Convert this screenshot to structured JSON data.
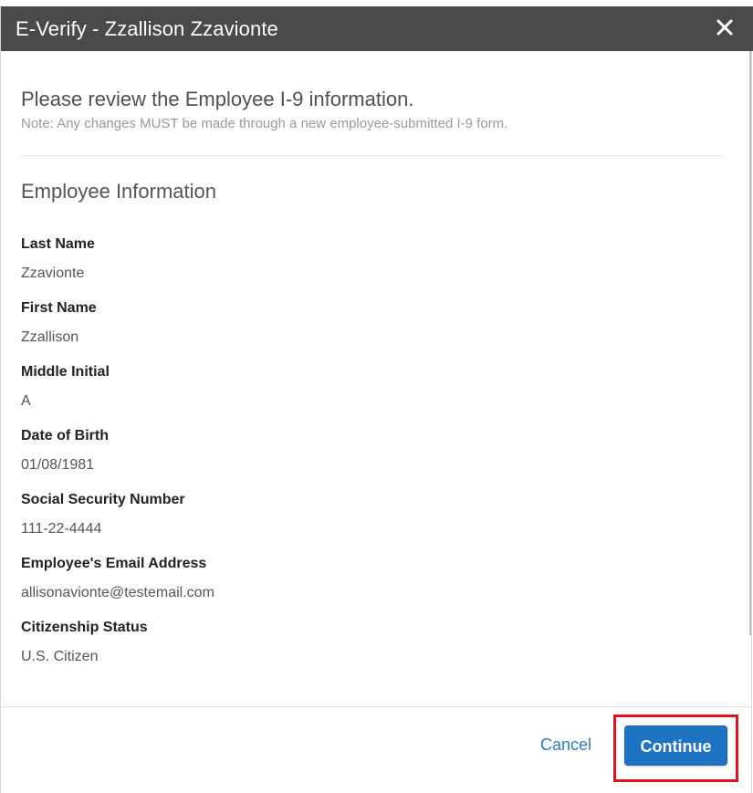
{
  "dialog": {
    "title": "E-Verify - Zzallison Zzavionte",
    "close_icon": "close-icon"
  },
  "review": {
    "heading": "Please review the Employee I-9 information.",
    "note": "Note: Any changes MUST be made through a new employee-submitted I-9 form."
  },
  "employee_section": {
    "heading": "Employee Information",
    "fields": [
      {
        "label": "Last Name",
        "value": "Zzavionte"
      },
      {
        "label": "First Name",
        "value": "Zzallison"
      },
      {
        "label": "Middle Initial",
        "value": "A"
      },
      {
        "label": "Date of Birth",
        "value": "01/08/1981"
      },
      {
        "label": "Social Security Number",
        "value": "111-22-4444"
      },
      {
        "label": "Employee's Email Address",
        "value": "allisonavionte@testemail.com"
      },
      {
        "label": "Citizenship Status",
        "value": "U.S. Citizen"
      }
    ]
  },
  "footer": {
    "cancel_label": "Cancel",
    "continue_label": "Continue"
  },
  "colors": {
    "titlebar": "#4a4a4a",
    "primary": "#1f73c3",
    "link": "#2e7fc1",
    "highlight": "#e0141e"
  }
}
